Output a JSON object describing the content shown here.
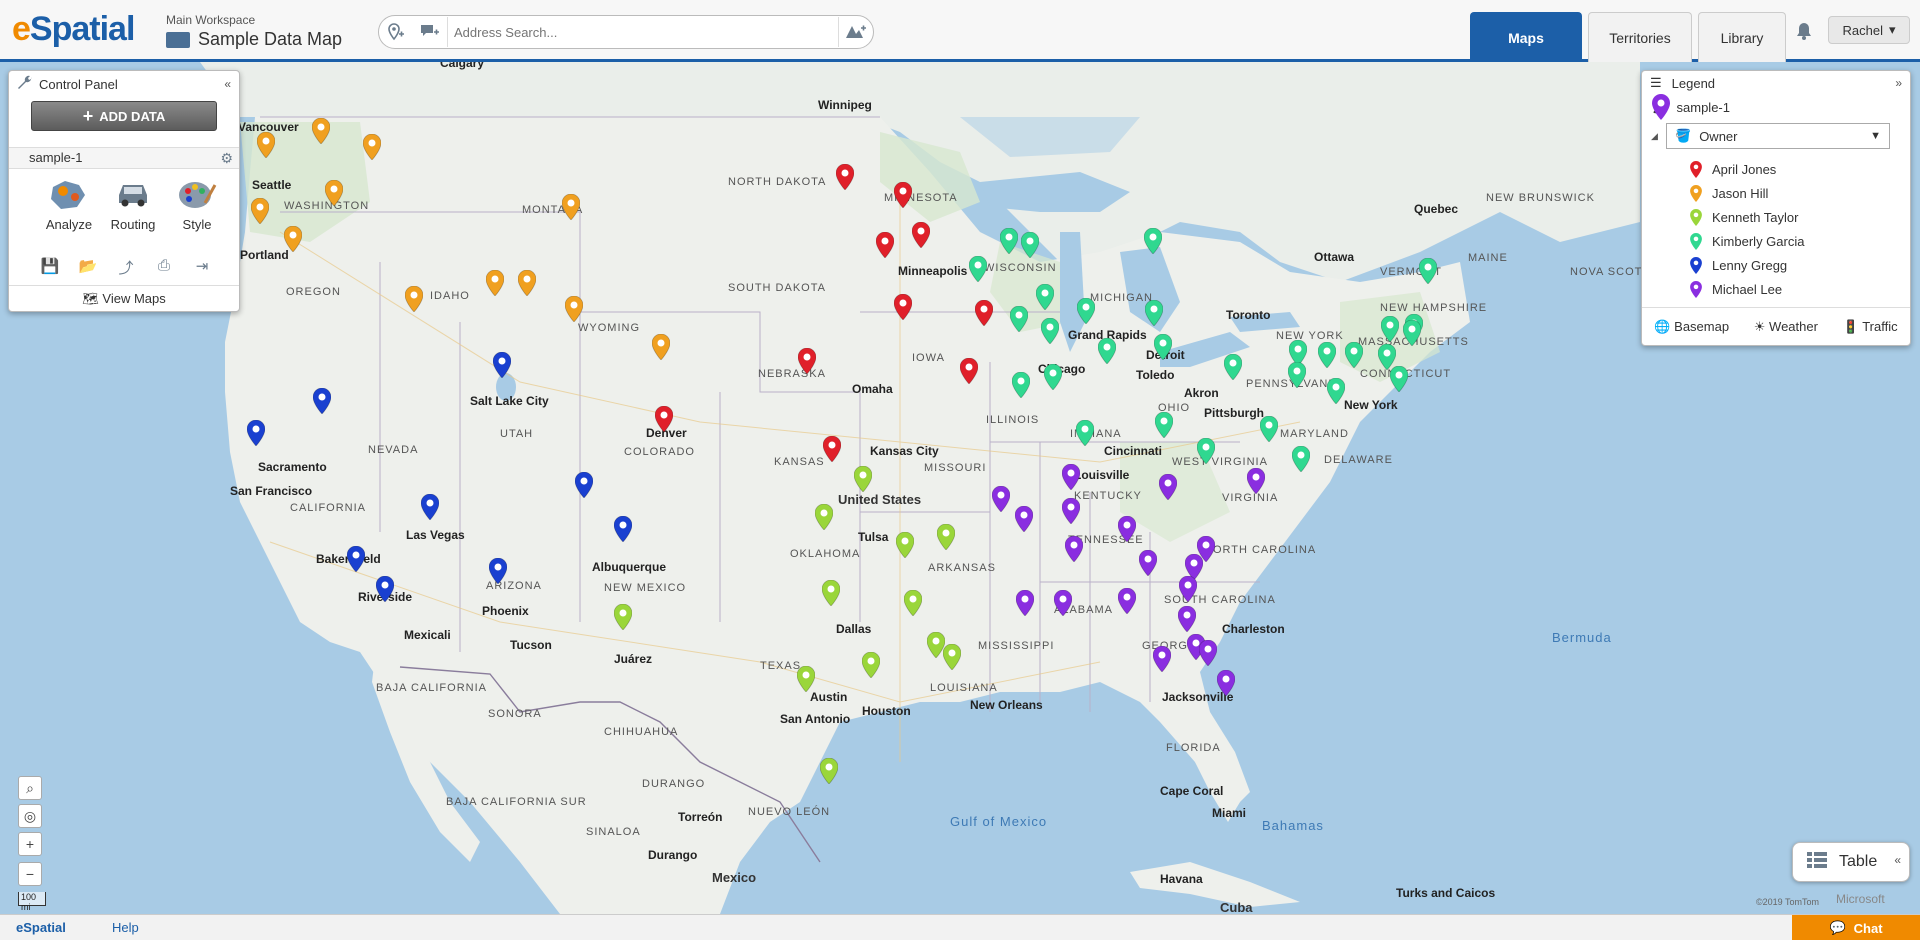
{
  "header": {
    "logo_e": "e",
    "logo_rest": "Spatial",
    "workspace": "Main Workspace",
    "map_name": "Sample Data Map",
    "search_placeholder": "Address Search...",
    "tabs": [
      {
        "label": "Maps",
        "active": true
      },
      {
        "label": "Territories",
        "active": false
      },
      {
        "label": "Library",
        "active": false
      }
    ],
    "user": "Rachel",
    "brand_blue": "#1c5fa8",
    "brand_orange": "#f08a00"
  },
  "control_panel": {
    "title": "Control Panel",
    "add_data": "ADD DATA",
    "layer": "sample-1",
    "tools": [
      "Analyze",
      "Routing",
      "Style"
    ],
    "view_maps": "View Maps"
  },
  "legend": {
    "title": "Legend",
    "layer": "sample-1",
    "group_by": "Owner",
    "owners": [
      {
        "name": "April Jones",
        "color": "#e0202a"
      },
      {
        "name": "Jason Hill",
        "color": "#f0a020"
      },
      {
        "name": "Kenneth Taylor",
        "color": "#9ad63a"
      },
      {
        "name": "Kimberly Garcia",
        "color": "#30d890"
      },
      {
        "name": "Lenny Gregg",
        "color": "#1a40d0"
      },
      {
        "name": "Michael Lee",
        "color": "#8a2ee0"
      }
    ],
    "footer": [
      "Basemap",
      "Weather",
      "Traffic"
    ]
  },
  "map": {
    "labels": {
      "countries": [
        "United States",
        "Mexico"
      ],
      "water": [
        "Gulf of Mexico",
        "Bermuda",
        "Bahamas",
        "Havana",
        "Cuba",
        "Turks and Caicos"
      ],
      "states": [
        "WASHINGTON",
        "OREGON",
        "IDAHO",
        "MONTANA",
        "WYOMING",
        "NORTH DAKOTA",
        "SOUTH DAKOTA",
        "NEBRASKA",
        "KANSAS",
        "OKLAHOMA",
        "TEXAS",
        "COLORADO",
        "UTAH",
        "NEVADA",
        "CALIFORNIA",
        "ARIZONA",
        "NEW MEXICO",
        "MINNESOTA",
        "IOWA",
        "MISSOURI",
        "ARKANSAS",
        "LOUISIANA",
        "MISSISSIPPI",
        "ALABAMA",
        "TENNESSEE",
        "KENTUCKY",
        "ILLINOIS",
        "INDIANA",
        "OHIO",
        "MICHIGAN",
        "WISCONSIN",
        "GEORGIA",
        "FLORIDA",
        "SOUTH CAROLINA",
        "NORTH CAROLINA",
        "VIRGINIA",
        "WEST VIRGINIA",
        "PENNSYLVANIA",
        "NEW YORK",
        "MARYLAND",
        "DELAWARE",
        "CONNECTICUT",
        "MASSACHUSETTS",
        "VERMONT",
        "NEW HAMPSHIRE",
        "MAINE",
        "NEW BRUNSWICK",
        "NOVA SCOTIA",
        "BAJA CALIFORNIA",
        "BAJA CALIFORNIA SUR",
        "SONORA",
        "CHIHUAHUA",
        "DURANGO",
        "SINALOA",
        "NUEVO LEÓN"
      ],
      "cities": [
        "Calgary",
        "Winnipeg",
        "Vancouver",
        "Seattle",
        "Portland",
        "Salt Lake City",
        "Sacramento",
        "San Francisco",
        "Las Vegas",
        "Bakersfield",
        "Riverside",
        "Mexicali",
        "Phoenix",
        "Tucson",
        "Albuquerque",
        "Juárez",
        "Denver",
        "Omaha",
        "Minneapolis",
        "Kansas City",
        "Tulsa",
        "Dallas",
        "Austin",
        "San Antonio",
        "Houston",
        "New Orleans",
        "Chicago",
        "Grand Rapids",
        "Detroit",
        "Toledo",
        "Akron",
        "Pittsburgh",
        "Cincinnati",
        "Louisville",
        "Charleston",
        "Jacksonville",
        "Cape Coral",
        "Miami",
        "New York",
        "Toronto",
        "Ottawa",
        "Quebec",
        "Torreón",
        "Durango"
      ]
    },
    "scale": "100 mi",
    "copyright": "©2019 TomTom",
    "microsoft": "Microsoft"
  },
  "table_button": "Table",
  "footer": {
    "logo": "eSpatial",
    "help": "Help",
    "chat": "Chat"
  }
}
